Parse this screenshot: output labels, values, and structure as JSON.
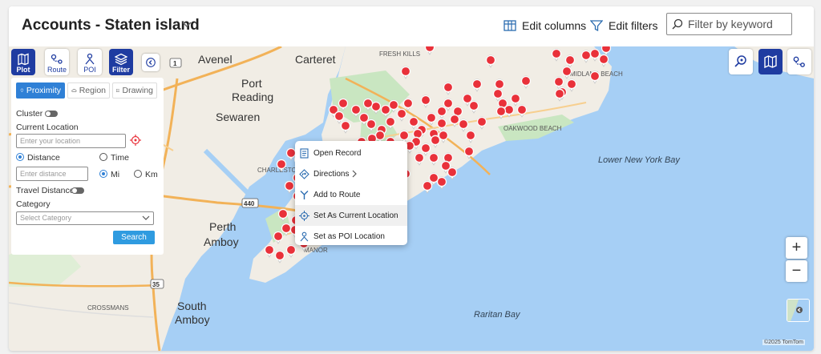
{
  "header": {
    "title": "Accounts - Staten island",
    "edit_columns": "Edit columns",
    "edit_filters": "Edit filters",
    "keyword_placeholder": "Filter by keyword"
  },
  "toolbar": {
    "plot": "Plot",
    "route": "Route",
    "poi": "POI",
    "filter": "Filter"
  },
  "panel": {
    "tabs": [
      "Proximity",
      "Region",
      "Drawing"
    ],
    "cluster": "Cluster",
    "current_location": "Current Location",
    "location_placeholder": "Enter your location",
    "distance": "Distance",
    "time": "Time",
    "distance_placeholder": "Enter distance",
    "mi": "Mi",
    "km": "Km",
    "travel_distance": "Travel Distance",
    "category": "Category",
    "category_placeholder": "Select Category",
    "search": "Search"
  },
  "context_menu": [
    "Open Record",
    "Directions",
    "Add to Route",
    "Set As Current Location",
    "Set as POI Location"
  ],
  "map": {
    "attribution": "©2025 TomTom",
    "places": [
      "Avenel",
      "Carteret",
      "Port",
      "Reading",
      "Sewaren",
      "FRESH KILLS",
      "MIDLAND BEACH",
      "OAKWOOD BEACH",
      "Lower New York Bay",
      "CHARLESTON",
      "Perth",
      "Amboy",
      "MANOR",
      "Raritan Bay",
      "CROSSMANS",
      "South",
      "Amboy"
    ],
    "roads": [
      "1",
      "440",
      "35"
    ]
  },
  "colors": {
    "brand": "#1f3ca1",
    "accent": "#2f80d6",
    "pin": "#e9313a",
    "water": "#a6cff5",
    "land": "#f1ede5",
    "park": "#c9e6c1"
  }
}
